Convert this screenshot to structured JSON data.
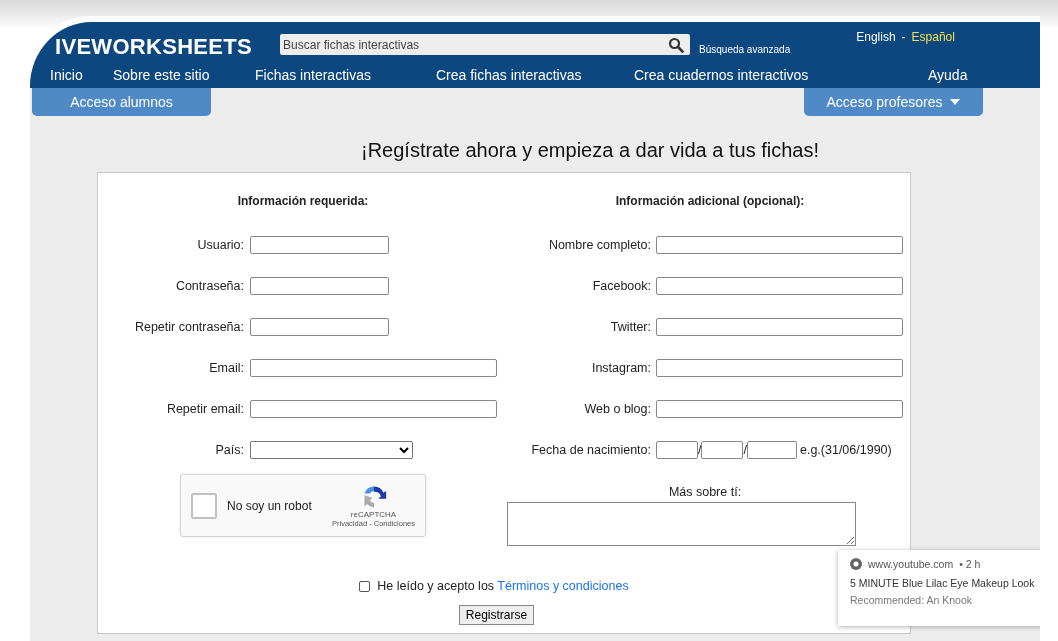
{
  "header": {
    "logo": "IVEWORKSHEETS",
    "search_placeholder": "Buscar fichas interactivas",
    "advanced_search": "Búsqueda avanzada",
    "languages": [
      {
        "label": "English",
        "selected": false
      },
      {
        "label": "Español",
        "selected": true
      }
    ],
    "separator": "-",
    "nav": [
      "Inicio",
      "Sobre este sitio",
      "Fichas interactivas",
      "Crea fichas interactivas",
      "Crea cuadernos interactivos",
      "Ayuda"
    ]
  },
  "access_tabs": [
    {
      "label": "Acceso alumnos",
      "dropdown": false
    },
    {
      "label": "Acceso profesores",
      "dropdown": true
    }
  ],
  "heading": "¡Regístrate ahora y empieza a dar vida a tus fichas!",
  "required": {
    "title": "Información requerida:",
    "fields": [
      {
        "label": "Usuario:",
        "kind": "text"
      },
      {
        "label": "Contraseña:",
        "kind": "text"
      },
      {
        "label": "Repetir contraseña:",
        "kind": "text"
      },
      {
        "label": "Email:",
        "kind": "wide"
      },
      {
        "label": "Repetir email:",
        "kind": "wide"
      },
      {
        "label": "País:",
        "kind": "select"
      }
    ]
  },
  "captcha": {
    "label": "No soy un robot",
    "checked": false,
    "brand": "reCAPTCHA",
    "links": "Privacidad - Condiciones"
  },
  "optional": {
    "title": "Información adicional (opcional):",
    "fields": [
      {
        "label": "Nombre completo:",
        "kind": "text"
      },
      {
        "label": "Facebook:",
        "kind": "text"
      },
      {
        "label": "Twitter:",
        "kind": "text"
      },
      {
        "label": "Instagram:",
        "kind": "text"
      },
      {
        "label": "Web o blog:",
        "kind": "text"
      },
      {
        "label": "Fecha de nacimiento:",
        "kind": "date",
        "separators": [
          "/",
          "/"
        ],
        "hint": "e.g.(31/06/1990)"
      }
    ],
    "about_label": "Más sobre tí:"
  },
  "terms": {
    "checked": false,
    "text": "He leído y acepto los",
    "link": "Términos y condiciones"
  },
  "submit": "Registrarse",
  "notification": {
    "source": "www.youtube.com",
    "time": "• 2 h",
    "title": "5 MINUTE Blue Lilac Eye Makeup Look",
    "subtitle": "Recommended: An Knook"
  }
}
